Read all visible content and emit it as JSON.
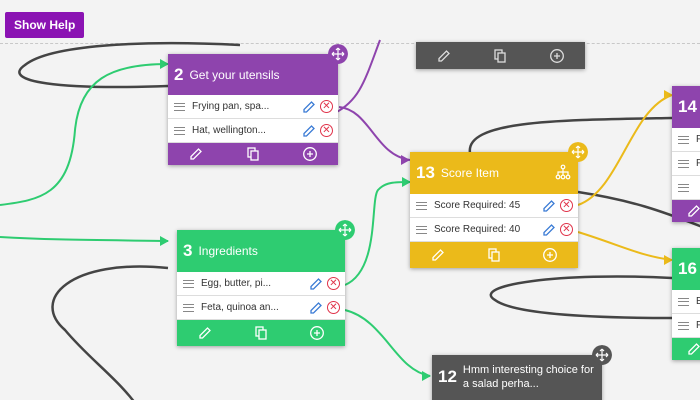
{
  "toolbar": {
    "help_label": "Show Help"
  },
  "colors": {
    "purple": "#8e44ad",
    "green": "#2ecc71",
    "yellow": "#ebba1a",
    "dark": "#555555",
    "delete": "#e0334a",
    "help_button": "#8b13b3"
  },
  "nodes": {
    "utensils": {
      "number": "2",
      "title": "Get your utensils",
      "items": [
        "Frying pan, spa...",
        "Hat, wellington..."
      ]
    },
    "ingredients": {
      "number": "3",
      "title": "Ingredients",
      "items": [
        "Egg, butter, pi...",
        "Feta, quinoa an..."
      ]
    },
    "score": {
      "number": "13",
      "title": "Score Item",
      "items": [
        "Score Required: 45",
        "Score Required: 40"
      ]
    },
    "salad": {
      "number": "12",
      "title": "Hmm interesting choice for a salad perha..."
    },
    "partial_14": {
      "number": "14",
      "items": [
        "F",
        "F",
        ""
      ]
    },
    "partial_16": {
      "number": "16",
      "items": [
        "E",
        "F"
      ]
    }
  },
  "icons": [
    "move-icon",
    "pencil-icon",
    "copy-icon",
    "add-icon",
    "delete-icon",
    "hierarchy-icon",
    "drag-handle-icon"
  ]
}
